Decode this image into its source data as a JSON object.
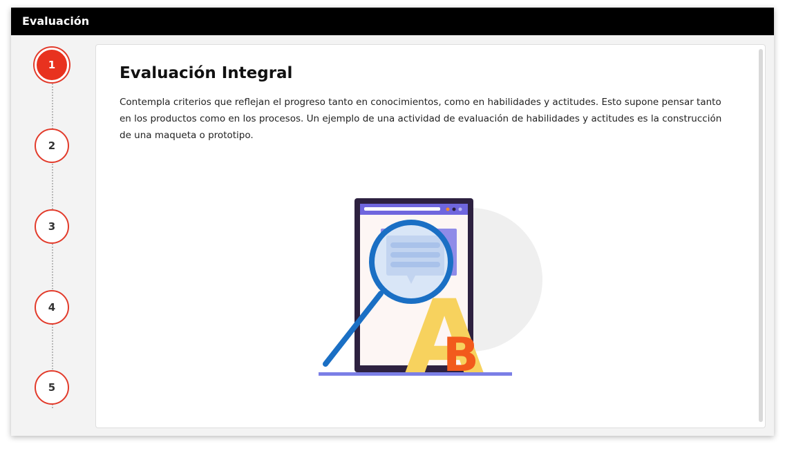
{
  "window": {
    "title": "Evaluación"
  },
  "steps": {
    "items": [
      {
        "label": "1",
        "active": true
      },
      {
        "label": "2",
        "active": false
      },
      {
        "label": "3",
        "active": false
      },
      {
        "label": "4",
        "active": false
      },
      {
        "label": "5",
        "active": false
      }
    ]
  },
  "content": {
    "heading": "Evaluación Integral",
    "body": "Contempla criterios que reflejan el progreso tanto en conocimientos, como en habilidades y actitudes. Esto supone pensar tanto en los productos como en los procesos. Un ejemplo de una actividad de evaluación de habilidades y actitudes es la construcción de una maqueta o prototipo.",
    "illustration_letters": {
      "a": "A",
      "b": "B"
    }
  },
  "colors": {
    "accent": "#e8321f",
    "titlebar": "#000000",
    "magnifier": "#1a6fc4",
    "tablet": "#2d2140",
    "letter_a": "#f7d25e",
    "letter_b": "#f25a1c",
    "lavender": "#7b7fe6"
  }
}
